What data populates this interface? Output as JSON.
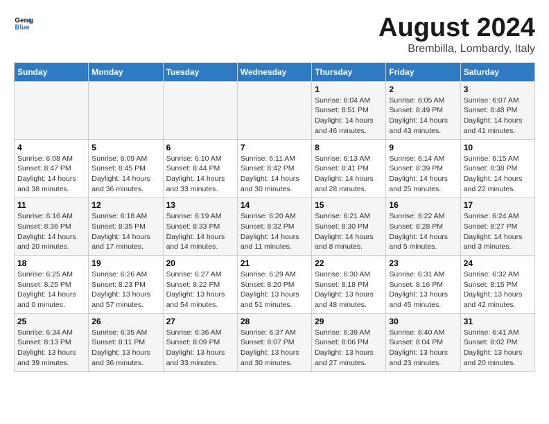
{
  "header": {
    "logo_line1": "General",
    "logo_line2": "Blue",
    "main_title": "August 2024",
    "subtitle": "Brembilla, Lombardy, Italy"
  },
  "days_of_week": [
    "Sunday",
    "Monday",
    "Tuesday",
    "Wednesday",
    "Thursday",
    "Friday",
    "Saturday"
  ],
  "weeks": [
    [
      {
        "day": "",
        "info": ""
      },
      {
        "day": "",
        "info": ""
      },
      {
        "day": "",
        "info": ""
      },
      {
        "day": "",
        "info": ""
      },
      {
        "day": "1",
        "info": "Sunrise: 6:04 AM\nSunset: 8:51 PM\nDaylight: 14 hours\nand 46 minutes."
      },
      {
        "day": "2",
        "info": "Sunrise: 6:05 AM\nSunset: 8:49 PM\nDaylight: 14 hours\nand 43 minutes."
      },
      {
        "day": "3",
        "info": "Sunrise: 6:07 AM\nSunset: 8:48 PM\nDaylight: 14 hours\nand 41 minutes."
      }
    ],
    [
      {
        "day": "4",
        "info": "Sunrise: 6:08 AM\nSunset: 8:47 PM\nDaylight: 14 hours\nand 38 minutes."
      },
      {
        "day": "5",
        "info": "Sunrise: 6:09 AM\nSunset: 8:45 PM\nDaylight: 14 hours\nand 36 minutes."
      },
      {
        "day": "6",
        "info": "Sunrise: 6:10 AM\nSunset: 8:44 PM\nDaylight: 14 hours\nand 33 minutes."
      },
      {
        "day": "7",
        "info": "Sunrise: 6:11 AM\nSunset: 8:42 PM\nDaylight: 14 hours\nand 30 minutes."
      },
      {
        "day": "8",
        "info": "Sunrise: 6:13 AM\nSunset: 8:41 PM\nDaylight: 14 hours\nand 28 minutes."
      },
      {
        "day": "9",
        "info": "Sunrise: 6:14 AM\nSunset: 8:39 PM\nDaylight: 14 hours\nand 25 minutes."
      },
      {
        "day": "10",
        "info": "Sunrise: 6:15 AM\nSunset: 8:38 PM\nDaylight: 14 hours\nand 22 minutes."
      }
    ],
    [
      {
        "day": "11",
        "info": "Sunrise: 6:16 AM\nSunset: 8:36 PM\nDaylight: 14 hours\nand 20 minutes."
      },
      {
        "day": "12",
        "info": "Sunrise: 6:18 AM\nSunset: 8:35 PM\nDaylight: 14 hours\nand 17 minutes."
      },
      {
        "day": "13",
        "info": "Sunrise: 6:19 AM\nSunset: 8:33 PM\nDaylight: 14 hours\nand 14 minutes."
      },
      {
        "day": "14",
        "info": "Sunrise: 6:20 AM\nSunset: 8:32 PM\nDaylight: 14 hours\nand 11 minutes."
      },
      {
        "day": "15",
        "info": "Sunrise: 6:21 AM\nSunset: 8:30 PM\nDaylight: 14 hours\nand 8 minutes."
      },
      {
        "day": "16",
        "info": "Sunrise: 6:22 AM\nSunset: 8:28 PM\nDaylight: 14 hours\nand 5 minutes."
      },
      {
        "day": "17",
        "info": "Sunrise: 6:24 AM\nSunset: 8:27 PM\nDaylight: 14 hours\nand 3 minutes."
      }
    ],
    [
      {
        "day": "18",
        "info": "Sunrise: 6:25 AM\nSunset: 8:25 PM\nDaylight: 14 hours\nand 0 minutes."
      },
      {
        "day": "19",
        "info": "Sunrise: 6:26 AM\nSunset: 8:23 PM\nDaylight: 13 hours\nand 57 minutes."
      },
      {
        "day": "20",
        "info": "Sunrise: 6:27 AM\nSunset: 8:22 PM\nDaylight: 13 hours\nand 54 minutes."
      },
      {
        "day": "21",
        "info": "Sunrise: 6:29 AM\nSunset: 8:20 PM\nDaylight: 13 hours\nand 51 minutes."
      },
      {
        "day": "22",
        "info": "Sunrise: 6:30 AM\nSunset: 8:18 PM\nDaylight: 13 hours\nand 48 minutes."
      },
      {
        "day": "23",
        "info": "Sunrise: 6:31 AM\nSunset: 8:16 PM\nDaylight: 13 hours\nand 45 minutes."
      },
      {
        "day": "24",
        "info": "Sunrise: 6:32 AM\nSunset: 8:15 PM\nDaylight: 13 hours\nand 42 minutes."
      }
    ],
    [
      {
        "day": "25",
        "info": "Sunrise: 6:34 AM\nSunset: 8:13 PM\nDaylight: 13 hours\nand 39 minutes."
      },
      {
        "day": "26",
        "info": "Sunrise: 6:35 AM\nSunset: 8:11 PM\nDaylight: 13 hours\nand 36 minutes."
      },
      {
        "day": "27",
        "info": "Sunrise: 6:36 AM\nSunset: 8:09 PM\nDaylight: 13 hours\nand 33 minutes."
      },
      {
        "day": "28",
        "info": "Sunrise: 6:37 AM\nSunset: 8:07 PM\nDaylight: 13 hours\nand 30 minutes."
      },
      {
        "day": "29",
        "info": "Sunrise: 6:39 AM\nSunset: 8:06 PM\nDaylight: 13 hours\nand 27 minutes."
      },
      {
        "day": "30",
        "info": "Sunrise: 6:40 AM\nSunset: 8:04 PM\nDaylight: 13 hours\nand 23 minutes."
      },
      {
        "day": "31",
        "info": "Sunrise: 6:41 AM\nSunset: 8:02 PM\nDaylight: 13 hours\nand 20 minutes."
      }
    ]
  ]
}
